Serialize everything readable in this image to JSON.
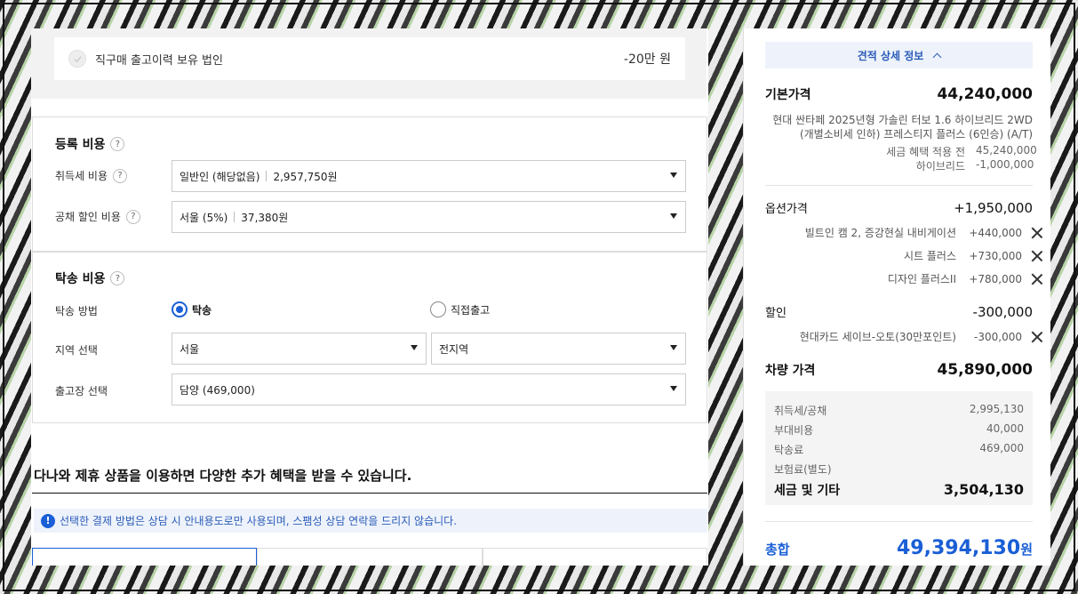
{
  "discount": {
    "label": "직구매 출고이력 보유 법인",
    "amount": "-20만 원"
  },
  "registration": {
    "title": "등록 비용",
    "rows": [
      {
        "label": "취득세 비용",
        "value": "일반인 (해당없음)",
        "amount": "2,957,750원"
      },
      {
        "label": "공채 할인 비용",
        "value": "서울 (5%)",
        "amount": "37,380원"
      }
    ]
  },
  "delivery": {
    "title": "탁송 비용",
    "method_label": "탁송 방법",
    "methods": [
      "탁송",
      "직접출고"
    ],
    "selected_method": "탁송",
    "region_label": "지역 선택",
    "region": "서울",
    "region_detail": "전지역",
    "depot_label": "출고장 선택",
    "depot": "담양 (469,000)"
  },
  "promo": {
    "title": "다나와 제휴 상품을 이용하면 다양한 추가 혜택을 받을 수 있습니다.",
    "notice": "선택한 결제 방법은 상담 시 안내용도로만 사용되며, 스팸성 상담 연락을 드리지 않습니다."
  },
  "summary": {
    "detail_button": "견적 상세 정보",
    "base": {
      "label": "기본가격",
      "value": "44,240,000",
      "desc1": "현대 싼타페 2025년형 가솔린 터보 1.6 하이브리드 2WD",
      "desc2": "(개별소비세 인하) 프레스티지 플러스 (6인승) (A/T)",
      "items": [
        {
          "k": "세금 혜택 적용 전",
          "v": "45,240,000"
        },
        {
          "k": "하이브리드",
          "v": "-1,000,000"
        }
      ]
    },
    "options": {
      "label": "옵션가격",
      "value": "+1,950,000",
      "items": [
        {
          "k": "빌트인 캠 2, 증강현실 내비게이션",
          "v": "+440,000"
        },
        {
          "k": "시트 플러스",
          "v": "+730,000"
        },
        {
          "k": "디자인 플러스II",
          "v": "+780,000"
        }
      ]
    },
    "discount": {
      "label": "할인",
      "value": "-300,000",
      "items": [
        {
          "k": "현대카드 세이브-오토(30만포인트)",
          "v": "-300,000"
        }
      ]
    },
    "car_price": {
      "label": "차량 가격",
      "value": "45,890,000"
    },
    "taxes": {
      "rows": [
        {
          "k": "취득세/공채",
          "v": "2,995,130"
        },
        {
          "k": "부대비용",
          "v": "40,000"
        },
        {
          "k": "탁송료",
          "v": "469,000"
        },
        {
          "k": "보험료(별도)",
          "v": ""
        }
      ],
      "total_label": "세금 및 기타",
      "total_value": "3,504,130"
    },
    "total": {
      "label": "총합",
      "value": "49,394,130",
      "unit": "원"
    }
  },
  "colors": {
    "accent": "#1a5fd6",
    "notice_bg": "#eef3fb"
  }
}
